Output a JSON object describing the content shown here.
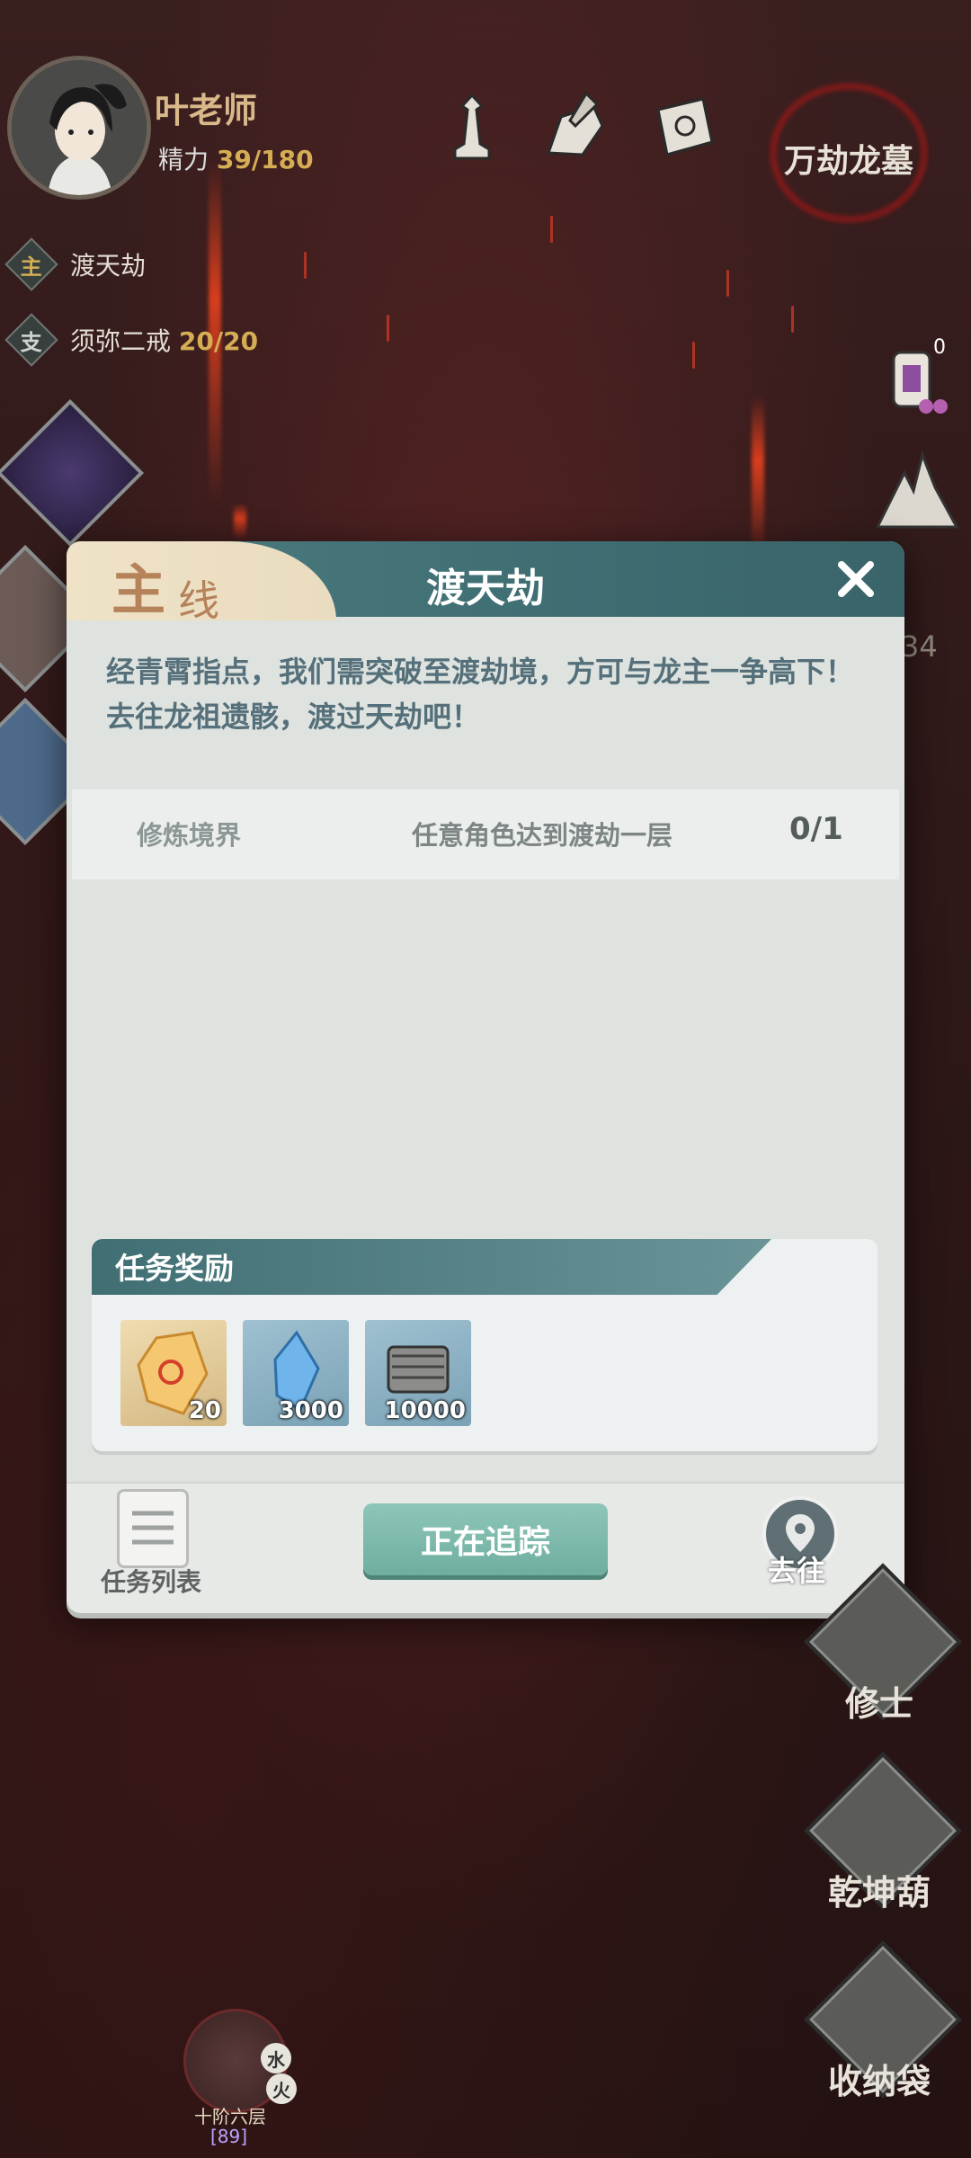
{
  "player": {
    "name": "叶老师",
    "energy_label": "精力",
    "energy_value": "39/180"
  },
  "location": "万劫龙墓",
  "quests": [
    {
      "tag": "主",
      "title": "渡天劫",
      "progress": ""
    },
    {
      "tag": "支",
      "title": "须弥二戒",
      "progress": "20/20"
    }
  ],
  "side_badge": {
    "count": "0"
  },
  "side_partial_number": "34",
  "modal": {
    "tab_main": "主",
    "tab_line": "线",
    "title": "渡天劫",
    "description": "经青霄指点，我们需突破至渡劫境，方可与龙主一争高下！去往龙祖遗骸，渡过天劫吧！",
    "objective": {
      "category": "修炼境界",
      "text": "任意角色达到渡劫一层",
      "progress": "0/1"
    },
    "rewards_title": "任务奖励",
    "rewards": [
      {
        "icon": "amber-crystal-icon",
        "count": "20"
      },
      {
        "icon": "blue-crystal-icon",
        "count": "3000"
      },
      {
        "icon": "scroll-bundle-icon",
        "count": "10000"
      }
    ],
    "list_label": "任务列表",
    "track_label": "正在追踪",
    "goto_label": "去往"
  },
  "right_buttons": [
    {
      "label": "修士"
    },
    {
      "label": "乾坤葫"
    },
    {
      "label": "收纳袋"
    }
  ],
  "bottom_character": {
    "element_1": "水",
    "element_2": "火",
    "level_text": "十阶六层",
    "level_num": "[89]"
  },
  "colors": {
    "accent_gold": "#d4ad55",
    "modal_teal": "#4d7c80",
    "track_green": "#7ab8a9"
  }
}
